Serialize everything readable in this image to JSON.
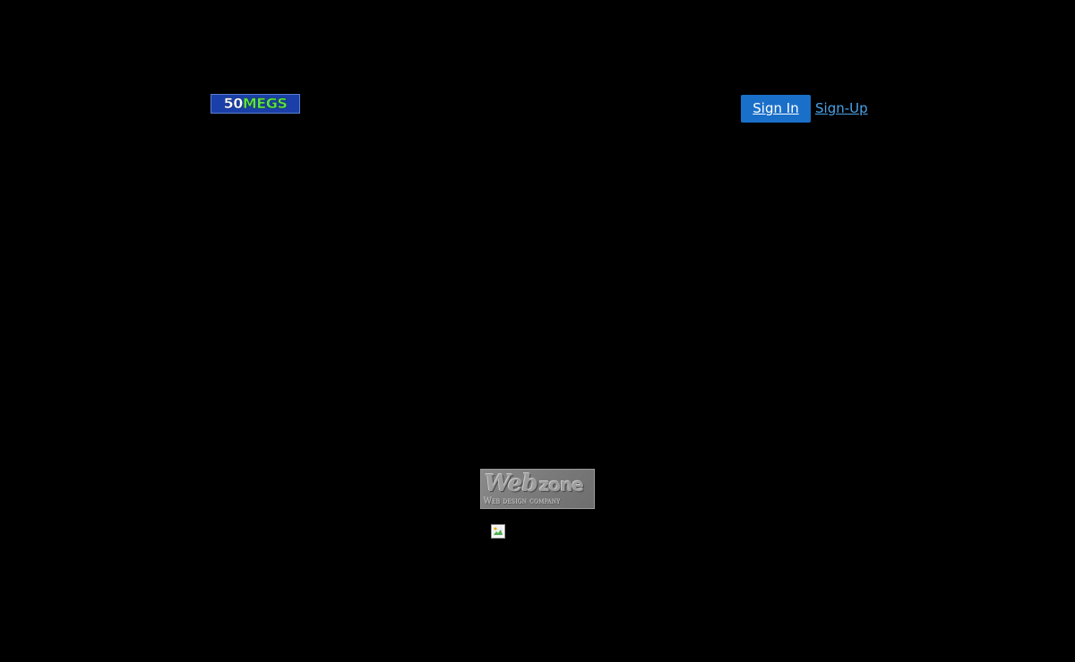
{
  "header": {
    "logo": {
      "number": "50",
      "word": "MEGS"
    },
    "signin_label": "Sign In",
    "signup_label": "Sign-Up"
  },
  "footer": {
    "webzone_badge": {
      "title_web": "Web",
      "title_zone": "zone",
      "subtitle": "Web design company"
    },
    "broken_image_icon": "broken-image-icon"
  },
  "colors": {
    "background": "#000000",
    "signin_bg": "#1a6fc9",
    "signup_link": "#4aa3e8",
    "logo_bg": "#1a3fa8",
    "logo_green": "#5fe04a"
  }
}
